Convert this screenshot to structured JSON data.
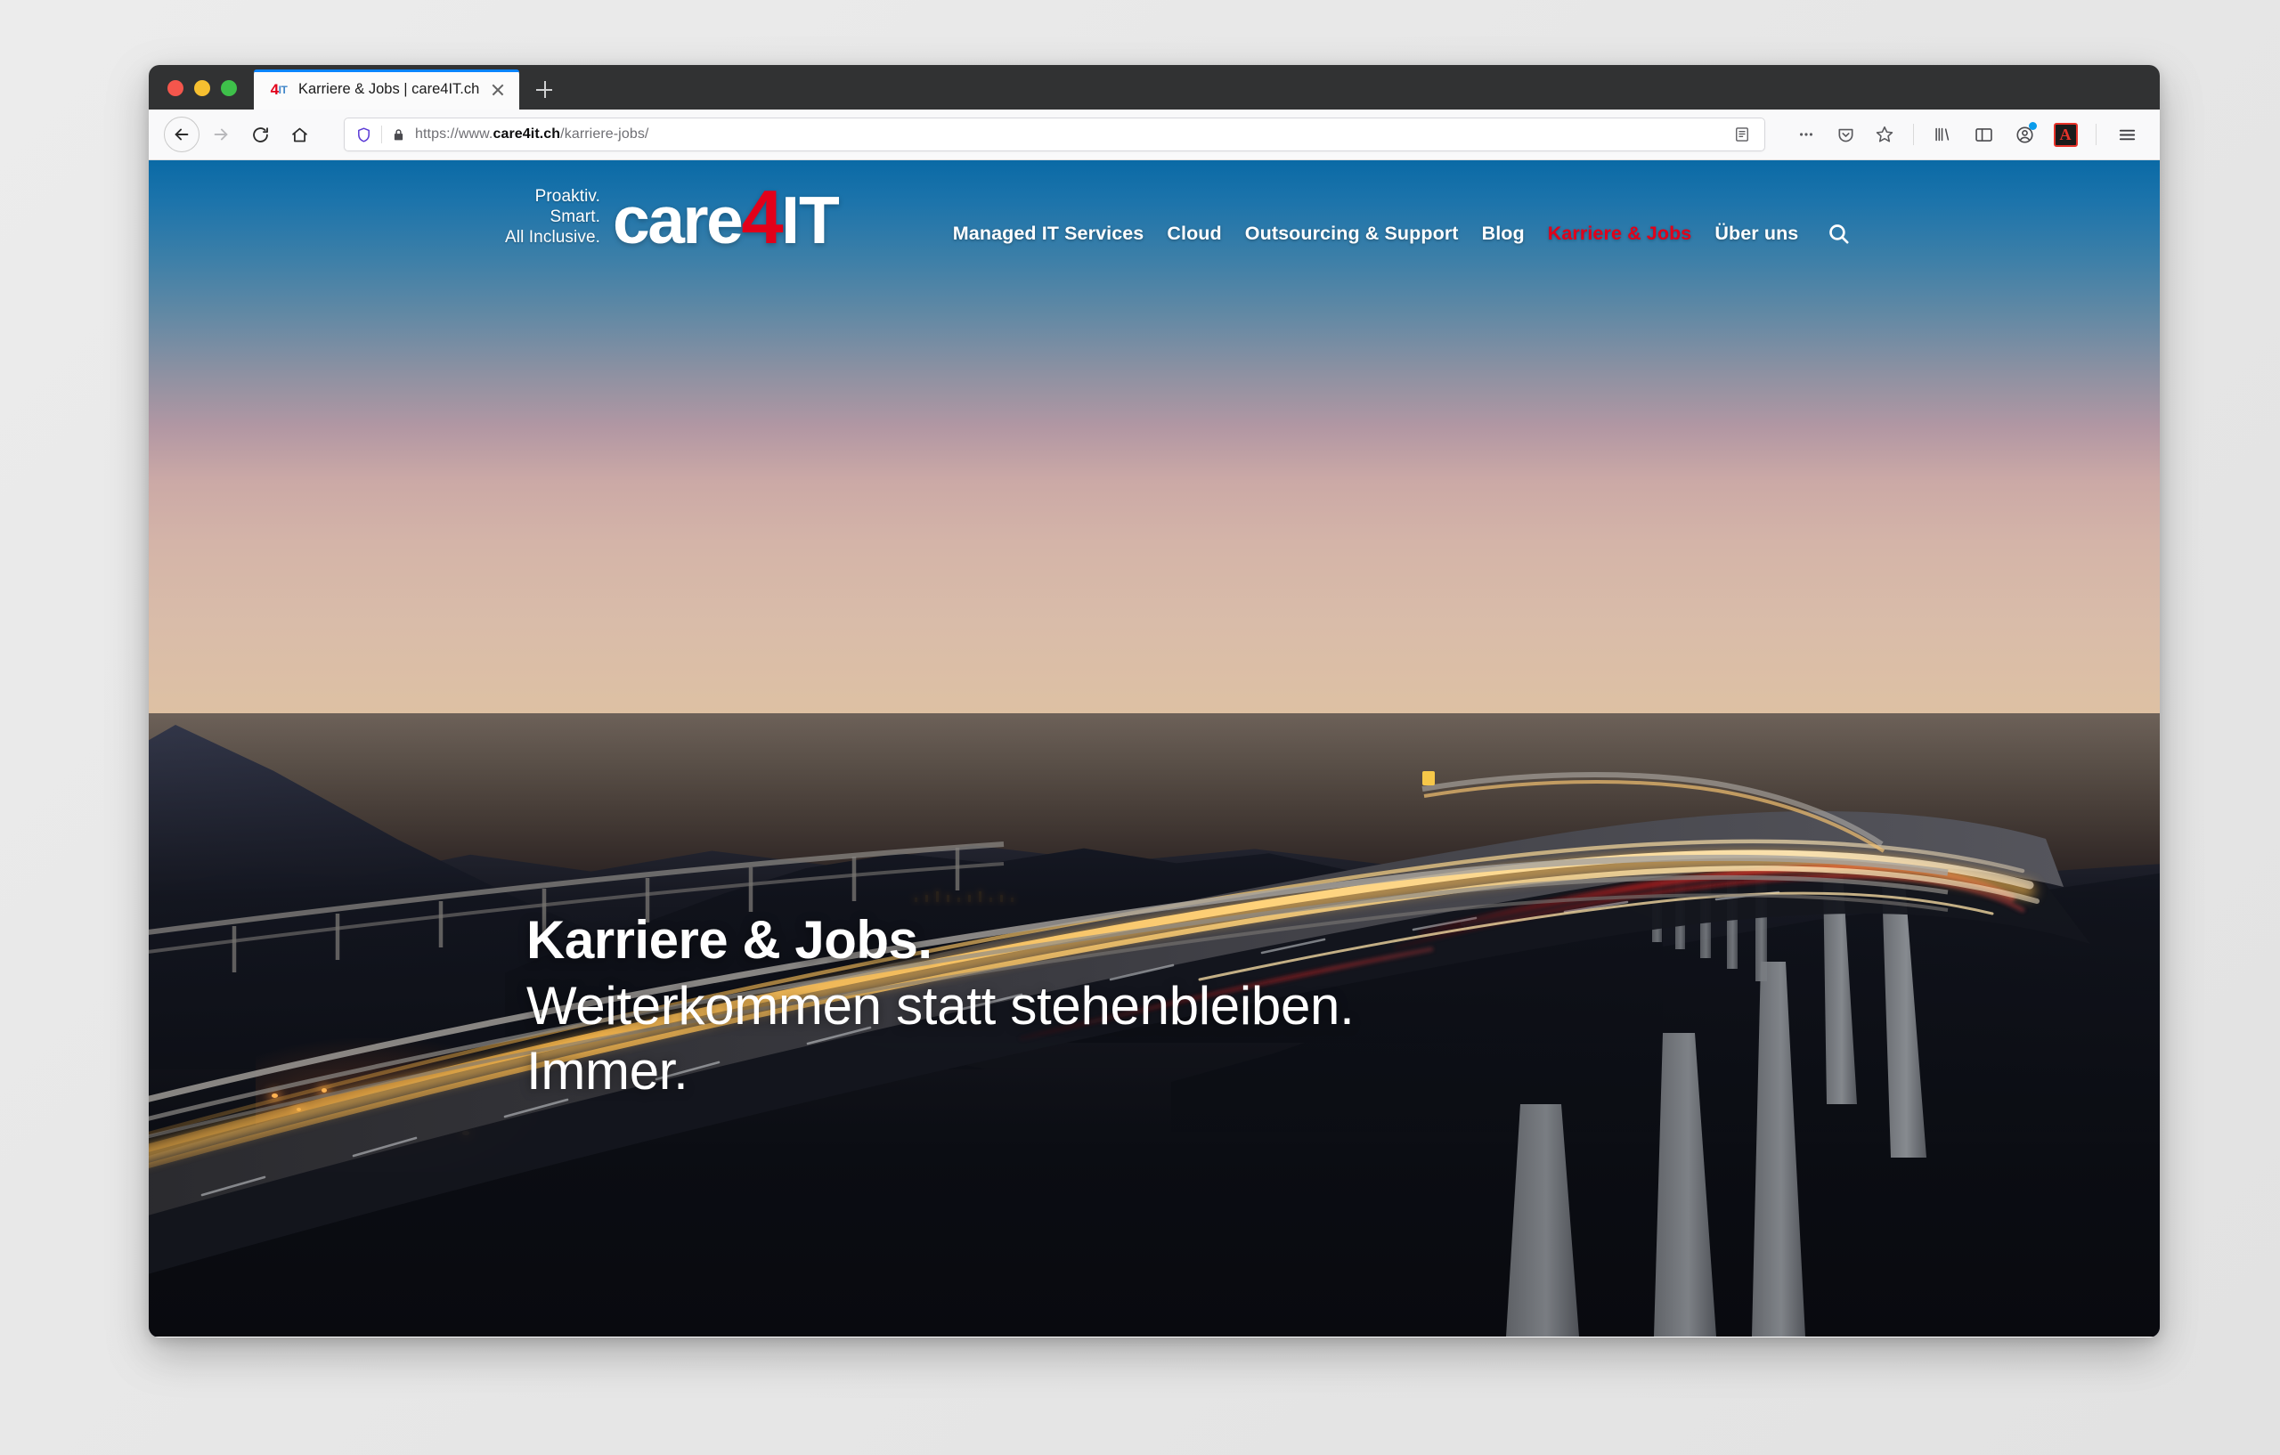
{
  "browser": {
    "tab": {
      "title": "Karriere & Jobs | care4IT.ch",
      "favicon_text_4": "4",
      "favicon_text_it": "IT",
      "close_label": "x"
    },
    "new_tab_label": "+",
    "toolbar": {
      "back_label": "Back",
      "forward_label": "Forward",
      "reload_label": "Reload",
      "home_label": "Home",
      "shield_label": "Enhanced Tracking Protection",
      "lock_label": "Secure connection",
      "reader_label": "Reader View",
      "page_actions_label": "...",
      "pocket_label": "Save to Pocket",
      "bookmark_label": "Bookmark this page",
      "library_label": "Library",
      "sidebar_label": "Sidebar",
      "account_label": "Account",
      "extension_label": "A",
      "menu_label": "Open menu"
    },
    "url": {
      "prefix": "https://www.",
      "domain": "care4it.ch",
      "path": "/karriere-jobs/",
      "full": "https://www.care4it.ch/karriere-jobs/"
    }
  },
  "site": {
    "logo": {
      "tagline_line1": "Proaktiv.",
      "tagline_line2": "Smart.",
      "tagline_line3": "All Inclusive.",
      "word_care": "care",
      "word_four": "4",
      "word_it": "IT",
      "accent_color": "#e2001a"
    },
    "nav": [
      {
        "label": "Managed IT Services",
        "active": false
      },
      {
        "label": "Cloud",
        "active": false
      },
      {
        "label": "Outsourcing & Support",
        "active": false
      },
      {
        "label": "Blog",
        "active": false
      },
      {
        "label": "Karriere & Jobs",
        "active": true
      },
      {
        "label": "Über uns",
        "active": false
      }
    ],
    "search_icon": "search-icon",
    "hero": {
      "line1": "Karriere & Jobs.",
      "line2": "Weiterkommen statt stehenbleiben.",
      "line3": "Immer.",
      "image_description": "Long-exposure photo of a curving highway viaduct at dusk with yellow and red car light trails, forested hills and a sunset sky"
    }
  }
}
